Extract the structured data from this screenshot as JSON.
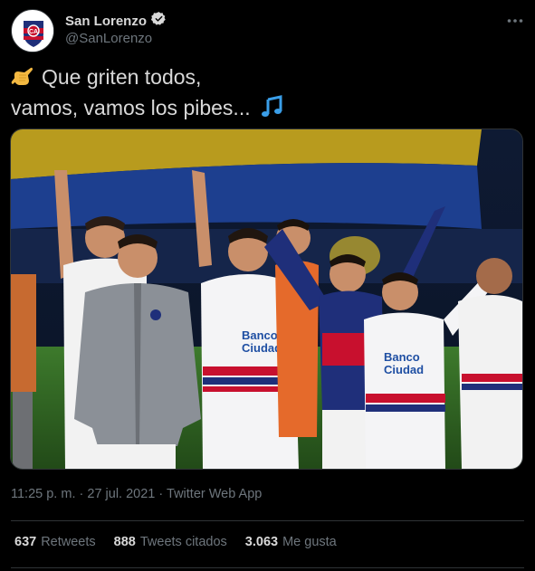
{
  "author": {
    "display_name": "San Lorenzo",
    "handle": "@SanLorenzo",
    "verified": true,
    "verified_icon": "verified-badge-icon"
  },
  "tweet": {
    "line1_emoji": "call-me-hand-emoji",
    "line1": "Que griten todos,",
    "line2": "vamos, vamos los pibes...",
    "line2_emoji": "musical-notes-emoji"
  },
  "media": {
    "description_icon": "team-celebration-photo",
    "jersey_text_line1": "Banco",
    "jersey_text_line2": "Ciudad"
  },
  "meta": {
    "time": "11:25 p. m.",
    "separator": "·",
    "date": "27 jul. 2021",
    "source": "Twitter Web App"
  },
  "stats": {
    "retweets_count": "637",
    "retweets_label": "Retweets",
    "quotes_count": "888",
    "quotes_label": "Tweets citados",
    "likes_count": "3.063",
    "likes_label": "Me gusta"
  },
  "colors": {
    "background": "#000000",
    "text": "#d9d9d9",
    "muted": "#6e767d",
    "divider": "#2f3336",
    "accent": "#1d9bf0",
    "club_red": "#c8102e",
    "club_blue": "#1f2f7a"
  }
}
